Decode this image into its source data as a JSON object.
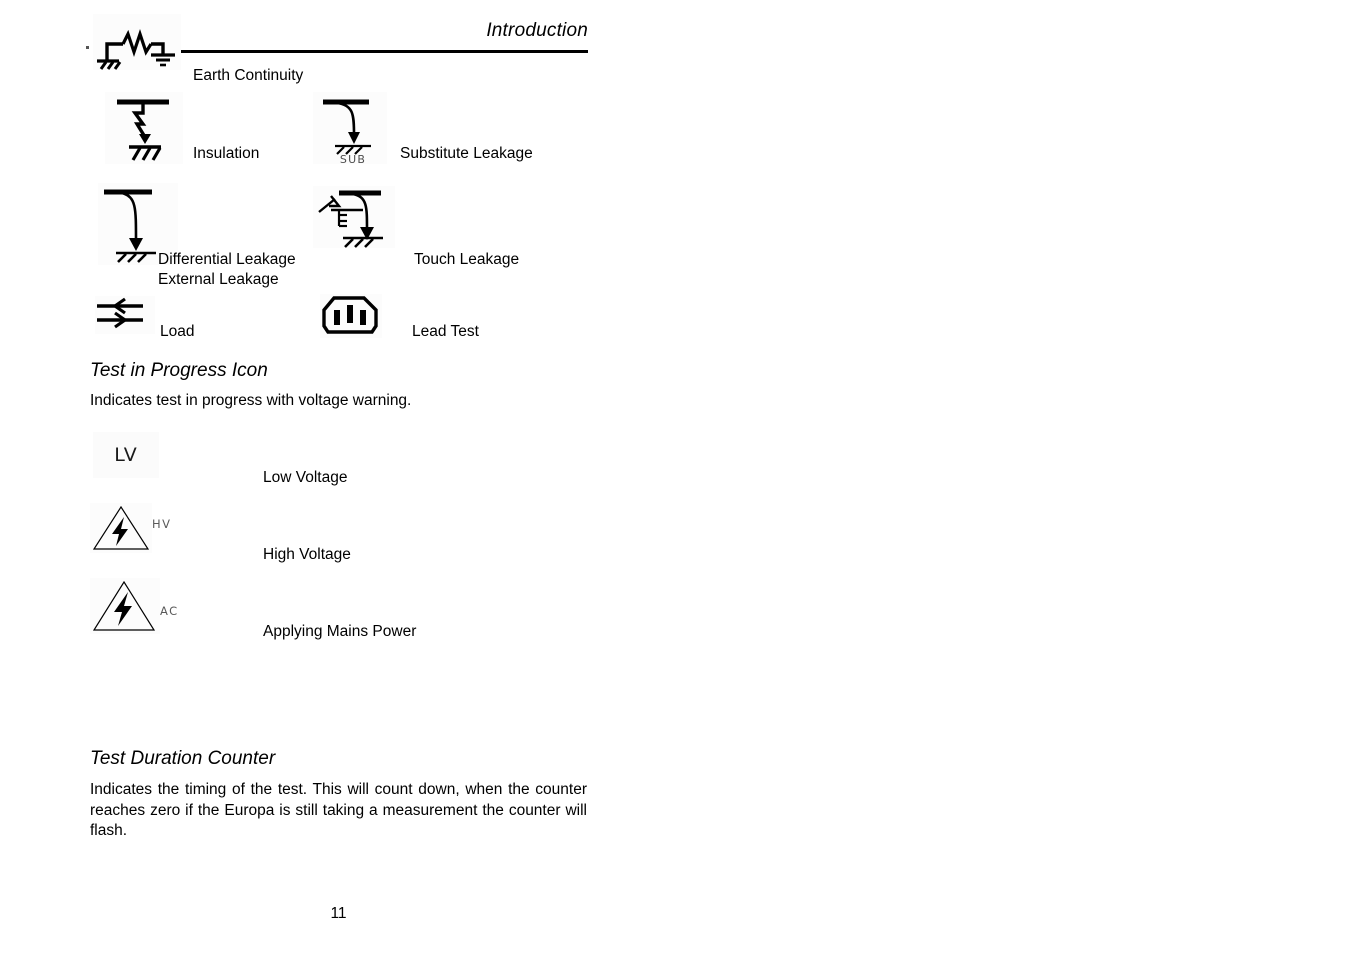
{
  "header": {
    "title": "Introduction"
  },
  "symbol_legend": [
    {
      "icon": "earth-continuity-icon",
      "label": "Earth Continuity"
    },
    {
      "icon": "insulation-icon",
      "label": "Insulation"
    },
    {
      "icon": "substitute-leakage-icon",
      "label": "Substitute Leakage",
      "icon_text": "SUB"
    },
    {
      "icon": "differential-leakage-icon",
      "label": "Differential Leakage"
    },
    {
      "icon": "differential-leakage-icon",
      "label": "External Leakage"
    },
    {
      "icon": "touch-leakage-icon",
      "label": "Touch Leakage"
    },
    {
      "icon": "load-icon",
      "label": "Load"
    },
    {
      "icon": "lead-test-icon",
      "label": "Lead Test"
    }
  ],
  "test_in_progress": {
    "heading": "Test in Progress Icon",
    "description": "Indicates test in progress with voltage warning.",
    "items": [
      {
        "icon": "low-voltage-icon",
        "icon_text": "LV",
        "label": "Low Voltage"
      },
      {
        "icon": "high-voltage-warning-icon",
        "icon_text": "HV",
        "label": "High Voltage"
      },
      {
        "icon": "mains-power-warning-icon",
        "icon_text": "AC",
        "label": "Applying Mains Power"
      }
    ]
  },
  "test_duration": {
    "heading": "Test Duration Counter",
    "description": "Indicates the timing of the test. This will count down, when the counter reaches zero if the Europa is still taking a measurement the counter will flash."
  },
  "footer": {
    "page_number": "11"
  }
}
